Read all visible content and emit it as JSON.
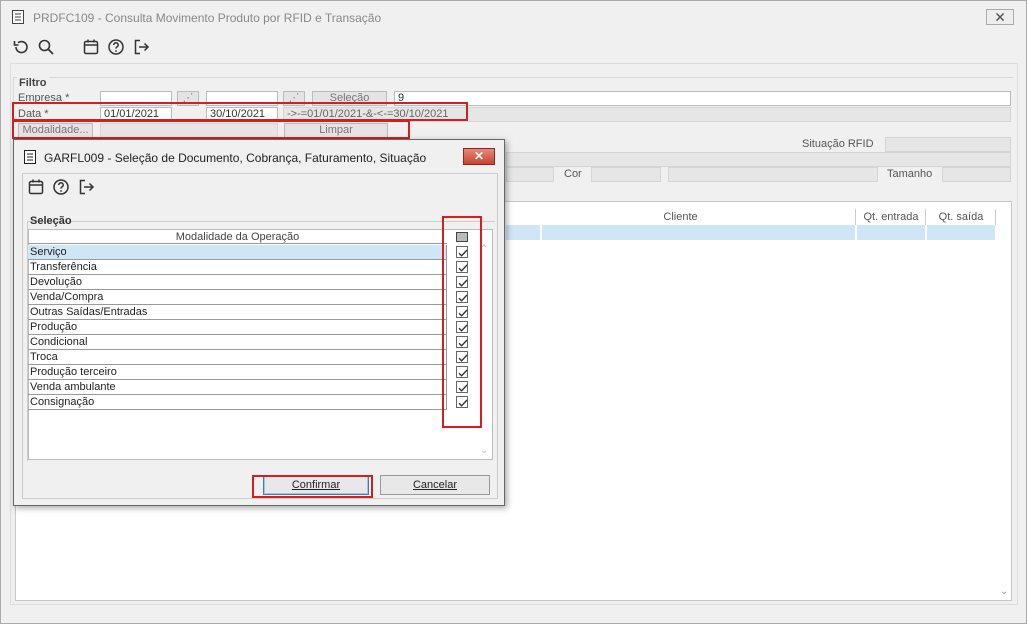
{
  "window": {
    "title": "PRDFC109 - Consulta Movimento Produto por RFID e Transação",
    "close_label": "🗙"
  },
  "toolbar": {
    "icons": [
      "undo-icon",
      "search-icon",
      "calendar-icon",
      "help-icon",
      "exit-icon"
    ]
  },
  "filtro": {
    "legend": "Filtro",
    "empresa_label": "Empresa *",
    "empresa_btn_label": "Seleção",
    "empresa_value": "9",
    "data_label": "Data *",
    "data_start": "01/01/2021",
    "data_end": "30/10/2021",
    "data_expr": "->-=01/01/2021-&-<-=30/10/2021",
    "modalidade_btn_label": "Modalidade...",
    "limpar_label": "Limpar",
    "situacao_rfid_label": "Situação RFID",
    "cor_label": "Cor",
    "tamanho_label": "Tamanho"
  },
  "grid": {
    "columns": [
      "Cliente",
      "Qt. entrada",
      "Qt. saída"
    ]
  },
  "dialog": {
    "title": "GARFL009 - Seleção de Documento, Cobrança, Faturamento, Situação",
    "close_label": "✕",
    "section_label": "Seleção",
    "column_header": "Modalidade da Operação",
    "items": [
      {
        "label": "Serviço",
        "checked": true
      },
      {
        "label": "Transferência",
        "checked": true
      },
      {
        "label": "Devolução",
        "checked": true
      },
      {
        "label": "Venda/Compra",
        "checked": true
      },
      {
        "label": "Outras Saídas/Entradas",
        "checked": true
      },
      {
        "label": "Produção",
        "checked": true
      },
      {
        "label": "Condicional",
        "checked": true
      },
      {
        "label": "Troca",
        "checked": true
      },
      {
        "label": "Produção terceiro",
        "checked": true
      },
      {
        "label": "Venda ambulante",
        "checked": true
      },
      {
        "label": "Consignação",
        "checked": true
      }
    ],
    "confirm_label": "Confirmar",
    "cancel_label": "Cancelar"
  },
  "colors": {
    "highlight": "#d21f1f",
    "selection": "#cfe6f6"
  }
}
